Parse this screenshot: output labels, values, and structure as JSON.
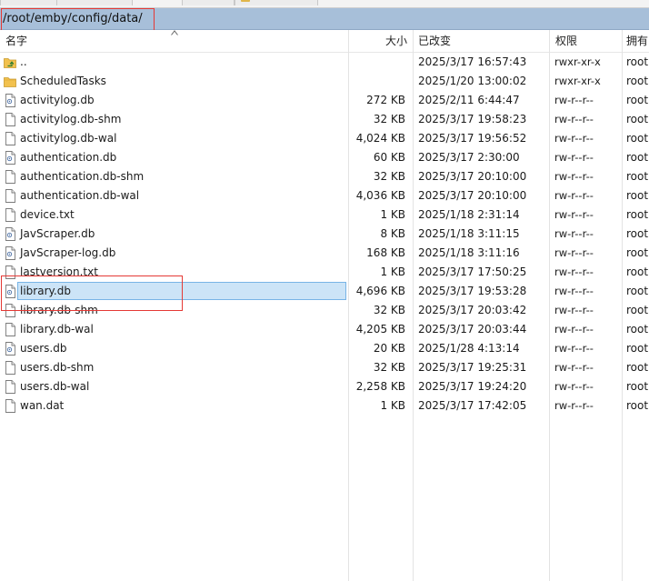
{
  "path": "/root/emby/config/data/",
  "columns": {
    "name": "名字",
    "size": "大小",
    "modified": "已改变",
    "permissions": "权限",
    "owner": "拥有"
  },
  "files": [
    {
      "name": "..",
      "size": "",
      "modified": "2025/3/17 16:57:43",
      "permissions": "rwxr-xr-x",
      "owner": "root",
      "icon": "parent-folder-icon"
    },
    {
      "name": "ScheduledTasks",
      "size": "",
      "modified": "2025/1/20 13:00:02",
      "permissions": "rwxr-xr-x",
      "owner": "root",
      "icon": "folder-icon"
    },
    {
      "name": "activitylog.db",
      "size": "272 KB",
      "modified": "2025/2/11 6:44:47",
      "permissions": "rw-r--r--",
      "owner": "root",
      "icon": "database-file-icon"
    },
    {
      "name": "activitylog.db-shm",
      "size": "32 KB",
      "modified": "2025/3/17 19:58:23",
      "permissions": "rw-r--r--",
      "owner": "root",
      "icon": "file-icon"
    },
    {
      "name": "activitylog.db-wal",
      "size": "4,024 KB",
      "modified": "2025/3/17 19:56:52",
      "permissions": "rw-r--r--",
      "owner": "root",
      "icon": "file-icon"
    },
    {
      "name": "authentication.db",
      "size": "60 KB",
      "modified": "2025/3/17 2:30:00",
      "permissions": "rw-r--r--",
      "owner": "root",
      "icon": "database-file-icon"
    },
    {
      "name": "authentication.db-shm",
      "size": "32 KB",
      "modified": "2025/3/17 20:10:00",
      "permissions": "rw-r--r--",
      "owner": "root",
      "icon": "file-icon"
    },
    {
      "name": "authentication.db-wal",
      "size": "4,036 KB",
      "modified": "2025/3/17 20:10:00",
      "permissions": "rw-r--r--",
      "owner": "root",
      "icon": "file-icon"
    },
    {
      "name": "device.txt",
      "size": "1 KB",
      "modified": "2025/1/18 2:31:14",
      "permissions": "rw-r--r--",
      "owner": "root",
      "icon": "file-icon"
    },
    {
      "name": "JavScraper.db",
      "size": "8 KB",
      "modified": "2025/1/18 3:11:15",
      "permissions": "rw-r--r--",
      "owner": "root",
      "icon": "database-file-icon"
    },
    {
      "name": "JavScraper-log.db",
      "size": "168 KB",
      "modified": "2025/1/18 3:11:16",
      "permissions": "rw-r--r--",
      "owner": "root",
      "icon": "database-file-icon"
    },
    {
      "name": "lastversion.txt",
      "size": "1 KB",
      "modified": "2025/3/17 17:50:25",
      "permissions": "rw-r--r--",
      "owner": "root",
      "icon": "file-icon"
    },
    {
      "name": "library.db",
      "size": "4,696 KB",
      "modified": "2025/3/17 19:53:28",
      "permissions": "rw-r--r--",
      "owner": "root",
      "icon": "database-file-icon",
      "selected": true
    },
    {
      "name": "library.db-shm",
      "size": "32 KB",
      "modified": "2025/3/17 20:03:42",
      "permissions": "rw-r--r--",
      "owner": "root",
      "icon": "file-icon"
    },
    {
      "name": "library.db-wal",
      "size": "4,205 KB",
      "modified": "2025/3/17 20:03:44",
      "permissions": "rw-r--r--",
      "owner": "root",
      "icon": "file-icon"
    },
    {
      "name": "users.db",
      "size": "20 KB",
      "modified": "2025/1/28 4:13:14",
      "permissions": "rw-r--r--",
      "owner": "root",
      "icon": "database-file-icon"
    },
    {
      "name": "users.db-shm",
      "size": "32 KB",
      "modified": "2025/3/17 19:25:31",
      "permissions": "rw-r--r--",
      "owner": "root",
      "icon": "file-icon"
    },
    {
      "name": "users.db-wal",
      "size": "2,258 KB",
      "modified": "2025/3/17 19:24:20",
      "permissions": "rw-r--r--",
      "owner": "root",
      "icon": "file-icon"
    },
    {
      "name": "wan.dat",
      "size": "1 KB",
      "modified": "2025/3/17 17:42:05",
      "permissions": "rw-r--r--",
      "owner": "root",
      "icon": "file-icon"
    }
  ],
  "colors": {
    "path_bar": "#a7bfd9",
    "selection": "#cce4f7",
    "annotation": "#e53935",
    "folder": "#f2c14e"
  }
}
